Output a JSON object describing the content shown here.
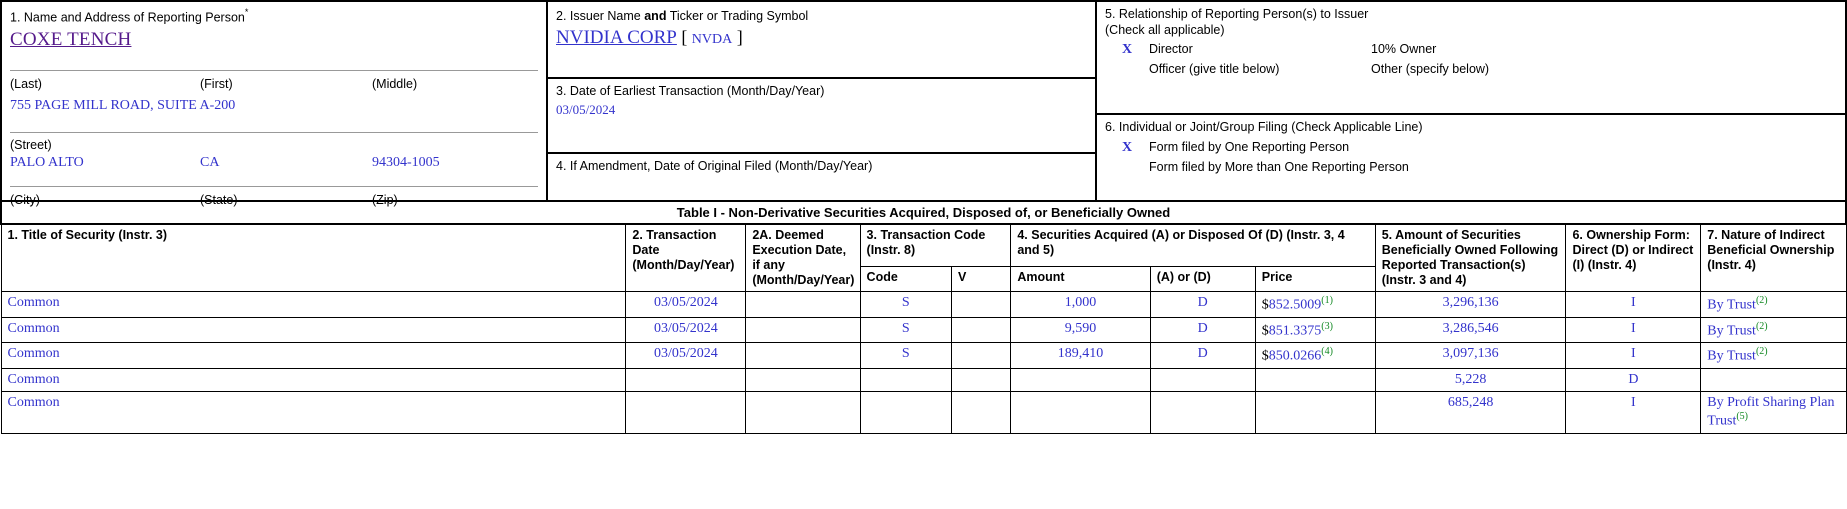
{
  "header": {
    "box1": {
      "label": "1. Name and Address of Reporting Person",
      "star": "*",
      "person_name": "COXE TENCH",
      "name_cols": {
        "last": "(Last)",
        "first": "(First)",
        "middle": "(Middle)"
      },
      "street_value": "755 PAGE MILL ROAD, SUITE A-200",
      "street_label": "(Street)",
      "city_value": "PALO ALTO",
      "state_value": "CA",
      "zip_value": "94304-1005",
      "city_label": "(City)",
      "state_label": "(State)",
      "zip_label": "(Zip)"
    },
    "box2": {
      "label_a": "2. Issuer Name ",
      "label_b": "and",
      "label_c": " Ticker or Trading Symbol",
      "issuer_name": "NVIDIA CORP",
      "ticker": "NVDA",
      "bracket_open": "[",
      "bracket_close": "]"
    },
    "box3": {
      "label": "3. Date of Earliest Transaction (Month/Day/Year)",
      "value": "03/05/2024"
    },
    "box4": {
      "label": "4. If Amendment, Date of Original Filed (Month/Day/Year)",
      "value": ""
    },
    "box5": {
      "label": "5. Relationship of Reporting Person(s) to Issuer",
      "sublabel": "(Check all applicable)",
      "director_mark": "X",
      "director_label": "Director",
      "owner10_mark": "",
      "owner10_label": "10% Owner",
      "officer_mark": "",
      "officer_label": "Officer (give title below)",
      "other_mark": "",
      "other_label": "Other (specify below)"
    },
    "box6": {
      "label": "6. Individual or Joint/Group Filing (Check Applicable Line)",
      "one_mark": "X",
      "one_label": "Form filed by One Reporting Person",
      "many_mark": "",
      "many_label": "Form filed by More than One Reporting Person"
    }
  },
  "table1": {
    "title": "Table I - Non-Derivative Securities Acquired, Disposed of, or Beneficially Owned",
    "headers": {
      "c1": "1. Title of Security (Instr. 3)",
      "c2": "2. Transaction Date (Month/Day/Year)",
      "c2a": "2A. Deemed Execution Date, if any (Month/Day/Year)",
      "c3": "3. Transaction Code (Instr. 8)",
      "c3_code": "Code",
      "c3_v": "V",
      "c4": "4. Securities Acquired (A) or Disposed Of (D) (Instr. 3, 4 and 5)",
      "c4_amount": "Amount",
      "c4_ad": "(A) or (D)",
      "c4_price": "Price",
      "c5": "5. Amount of Securities Beneficially Owned Following Reported Transaction(s) (Instr. 3 and 4)",
      "c6": "6. Ownership Form: Direct (D) or Indirect (I) (Instr. 4)",
      "c7": "7. Nature of Indirect Beneficial Ownership (Instr. 4)"
    },
    "rows": [
      {
        "title": "Common",
        "date": "03/05/2024",
        "deemed": "",
        "code": "S",
        "v": "",
        "amount": "1,000",
        "ad": "D",
        "price": "$852.5009",
        "price_fn": "(1)",
        "owned": "3,296,136",
        "ownership": "I",
        "nature": "By Trust",
        "nature_fn": "(2)"
      },
      {
        "title": "Common",
        "date": "03/05/2024",
        "deemed": "",
        "code": "S",
        "v": "",
        "amount": "9,590",
        "ad": "D",
        "price": "$851.3375",
        "price_fn": "(3)",
        "owned": "3,286,546",
        "ownership": "I",
        "nature": "By Trust",
        "nature_fn": "(2)"
      },
      {
        "title": "Common",
        "date": "03/05/2024",
        "deemed": "",
        "code": "S",
        "v": "",
        "amount": "189,410",
        "ad": "D",
        "price": "$850.0266",
        "price_fn": "(4)",
        "owned": "3,097,136",
        "ownership": "I",
        "nature": "By Trust",
        "nature_fn": "(2)"
      },
      {
        "title": "Common",
        "date": "",
        "deemed": "",
        "code": "",
        "v": "",
        "amount": "",
        "ad": "",
        "price": "",
        "price_fn": "",
        "owned": "5,228",
        "ownership": "D",
        "nature": "",
        "nature_fn": ""
      },
      {
        "title": "Common",
        "date": "",
        "deemed": "",
        "code": "",
        "v": "",
        "amount": "",
        "ad": "",
        "price": "",
        "price_fn": "",
        "owned": "685,248",
        "ownership": "I",
        "nature": "By Profit Sharing Plan Trust",
        "nature_fn": "(5)"
      }
    ]
  },
  "colors": {
    "data_blue": "#3333cc",
    "footnote_green": "#118822",
    "visited_link": "#551a8b"
  }
}
